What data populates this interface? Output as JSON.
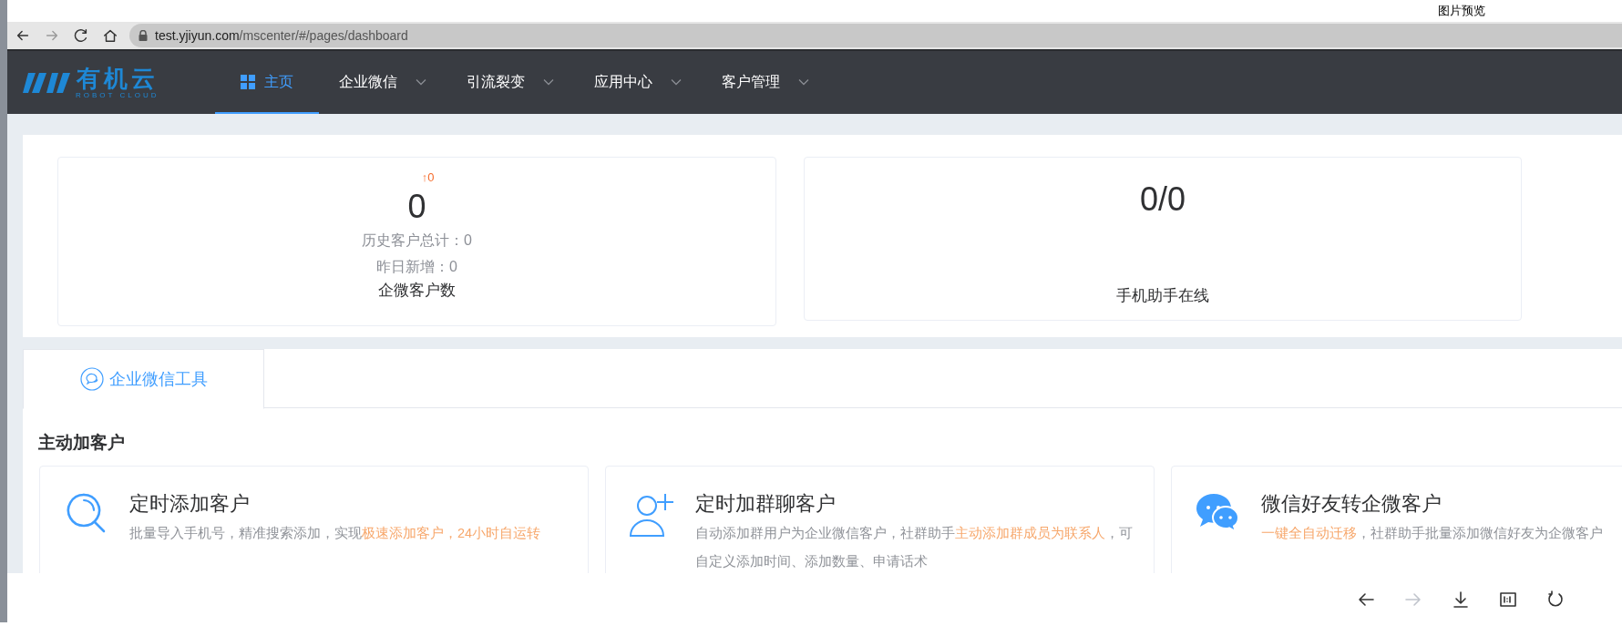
{
  "preview": {
    "title": "图片预览",
    "toolbar": [
      {
        "kind": "prev",
        "disabled": false
      },
      {
        "kind": "next",
        "disabled": true
      },
      {
        "kind": "download",
        "disabled": false
      },
      {
        "kind": "actual_size",
        "disabled": false
      },
      {
        "kind": "rotate",
        "disabled": false
      }
    ]
  },
  "browser": {
    "buttons": [
      {
        "kind": "back",
        "disabled": false
      },
      {
        "kind": "forward",
        "disabled": true
      },
      {
        "kind": "reload",
        "disabled": false
      },
      {
        "kind": "home",
        "disabled": false
      }
    ],
    "url_host": "test.yjiyun.com",
    "url_path": "/mscenter/#/pages/dashboard"
  },
  "header": {
    "logo_name": "有机云",
    "logo_tagline": "ROBOT CLOUD",
    "nav": [
      {
        "label": "主页",
        "selected": true,
        "dropdown": false
      },
      {
        "label": "企业微信",
        "selected": false,
        "dropdown": true
      },
      {
        "label": "引流裂变",
        "selected": false,
        "dropdown": true
      },
      {
        "label": "应用中心",
        "selected": false,
        "dropdown": true
      },
      {
        "label": "客户管理",
        "selected": false,
        "dropdown": true
      }
    ]
  },
  "stats": [
    {
      "delta": "↑0",
      "value": "0",
      "details": [
        "历史客户总计：0",
        "昨日新增：0"
      ],
      "label": "企微客户数"
    },
    {
      "value": "0/0",
      "label": "手机助手在线"
    }
  ],
  "tabs": [
    {
      "label": "企业微信工具",
      "selected": true
    }
  ],
  "section_title": "主动加客户",
  "tools": [
    {
      "kind": "search",
      "title": "定时添加客户",
      "description": [
        {
          "text": "批量导入手机号，精准搜索添加，实现",
          "highlight": false
        },
        {
          "text": "极速添加客户，24小时自运转",
          "highlight": true
        }
      ]
    },
    {
      "kind": "user_add",
      "title": "定时加群聊客户",
      "description": [
        {
          "text": "自动添加群用户为企业微信客户，社群助手",
          "highlight": false
        },
        {
          "text": "主动添加群成员为联系人",
          "highlight": true
        },
        {
          "text": "，可自定义添加时间、添加数量、申请话术",
          "highlight": false
        }
      ]
    },
    {
      "kind": "chat",
      "title": "微信好友转企微客户",
      "description": [
        {
          "text": "一键全自动迁移",
          "highlight": true
        },
        {
          "text": "，社群助手批量添加微信好友为企微客户",
          "highlight": false
        }
      ]
    }
  ]
}
